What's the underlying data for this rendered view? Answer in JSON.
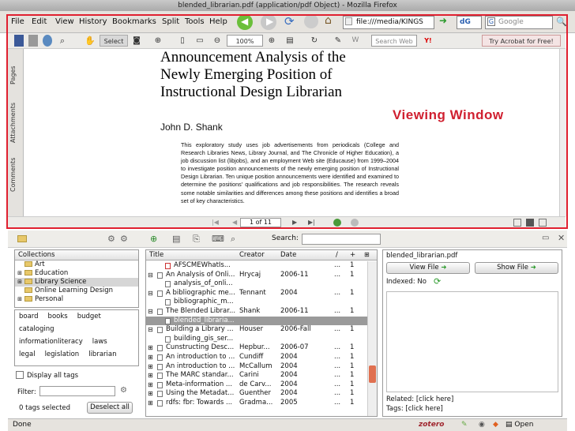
{
  "window": {
    "title": "blended_librarian.pdf (application/pdf Object) - Mozilla Firefox"
  },
  "menu": [
    "File",
    "Edit",
    "View",
    "History",
    "Bookmarks",
    "Split",
    "Tools",
    "Help"
  ],
  "nav": {
    "url": "file:///media/KINGS",
    "search_engine_label": "dG",
    "search_placeholder": "Google"
  },
  "pdf_toolbar": {
    "select_label": "Select",
    "zoom": "100%",
    "search_placeholder": "Search Web",
    "acrobat_label": "Try Acrobat for Free!"
  },
  "side_tabs": [
    "Pages",
    "Attachments",
    "Comments"
  ],
  "document": {
    "title_lines": [
      "Announcement Analysis of the",
      "Newly Emerging Position of",
      "Instructional Design Librarian"
    ],
    "author": "John D. Shank",
    "abstract": "This exploratory study uses job advertisements from periodicals (College and Research Libraries News, Library Journal, and The Chronicle of Higher Education), a job discussion list (libjobs), and an employment Web site (Educause) from 1999–2004 to investigate position announcements of the newly emerging position of Instructional Design Librarian. Ten unique position announcements were identified and examined to determine the positions' qualifications and job responsibilities. The research reveals some notable similarities and differences among these positions and identifies a broad set of key characteristics."
  },
  "annotation": {
    "viewing_window": "Viewing Window",
    "color": "#d02030"
  },
  "pdf_bottom": {
    "page": "1 of 11"
  },
  "zotero": {
    "search_label": "Search:",
    "collections_header": "Collections",
    "collections": [
      {
        "label": "Art",
        "expand": ""
      },
      {
        "label": "Education",
        "expand": "+"
      },
      {
        "label": "Library Science",
        "expand": "+"
      },
      {
        "label": "Online Learning Design",
        "expand": ""
      },
      {
        "label": "Personal",
        "expand": "+"
      }
    ],
    "tags": [
      [
        "board",
        "books",
        "budget"
      ],
      [
        "cataloging"
      ],
      [
        "informationliteracy",
        "laws"
      ],
      [
        "legal",
        "legislation",
        "librarian"
      ]
    ],
    "display_all_tags": "Display all tags",
    "filter_label": "Filter:",
    "tags_selected": "0 tags selected",
    "deselect_all": "Deselect all",
    "columns": {
      "title": "Title",
      "creator": "Creator",
      "date": "Date"
    },
    "items": [
      {
        "title": "AFSCMEWhatIs...",
        "creator": "",
        "date": "",
        "a": "...",
        "b": "1",
        "indent": 1,
        "expand": "",
        "pdf": true,
        "selected": false
      },
      {
        "title": "An Analysis of Onli...",
        "creator": "Hrycaj",
        "date": "2006-11",
        "a": "...",
        "b": "1",
        "indent": 0,
        "expand": "⊟",
        "pdf": false,
        "selected": false
      },
      {
        "title": "analysis_of_onli...",
        "creator": "",
        "date": "",
        "a": "",
        "b": "",
        "indent": 1,
        "expand": "",
        "pdf": false,
        "selected": false
      },
      {
        "title": "A bibliographic me...",
        "creator": "Tennant",
        "date": "2004",
        "a": "...",
        "b": "1",
        "indent": 0,
        "expand": "⊟",
        "pdf": false,
        "selected": false
      },
      {
        "title": "bibliographic_m...",
        "creator": "",
        "date": "",
        "a": "",
        "b": "",
        "indent": 1,
        "expand": "",
        "pdf": false,
        "selected": false
      },
      {
        "title": "The Blended Librar...",
        "creator": "Shank",
        "date": "2006-11",
        "a": "...",
        "b": "1",
        "indent": 0,
        "expand": "⊟",
        "pdf": false,
        "selected": false
      },
      {
        "title": "blended_libraria...",
        "creator": "",
        "date": "",
        "a": "",
        "b": "",
        "indent": 1,
        "expand": "",
        "pdf": false,
        "selected": true
      },
      {
        "title": "Building a Library ...",
        "creator": "Houser",
        "date": "2006-Fall",
        "a": "...",
        "b": "1",
        "indent": 0,
        "expand": "⊟",
        "pdf": false,
        "selected": false
      },
      {
        "title": "building_gis_ser...",
        "creator": "",
        "date": "",
        "a": "",
        "b": "",
        "indent": 1,
        "expand": "",
        "pdf": false,
        "selected": false
      },
      {
        "title": "Cunstructing Desc...",
        "creator": "Hepbur...",
        "date": "2006-07",
        "a": "...",
        "b": "1",
        "indent": 0,
        "expand": "⊞",
        "pdf": false,
        "selected": false
      },
      {
        "title": "An introduction to ...",
        "creator": "Cundiff",
        "date": "2004",
        "a": "...",
        "b": "1",
        "indent": 0,
        "expand": "⊞",
        "pdf": false,
        "selected": false
      },
      {
        "title": "An introduction to ...",
        "creator": "McCallum",
        "date": "2004",
        "a": "...",
        "b": "1",
        "indent": 0,
        "expand": "⊞",
        "pdf": false,
        "selected": false
      },
      {
        "title": "The MARC standar...",
        "creator": "Carini",
        "date": "2004",
        "a": "...",
        "b": "1",
        "indent": 0,
        "expand": "⊞",
        "pdf": false,
        "selected": false
      },
      {
        "title": "Meta-information ...",
        "creator": "de Carv...",
        "date": "2004",
        "a": "...",
        "b": "1",
        "indent": 0,
        "expand": "⊞",
        "pdf": false,
        "selected": false
      },
      {
        "title": "Using the Metadat...",
        "creator": "Guenther",
        "date": "2004",
        "a": "...",
        "b": "1",
        "indent": 0,
        "expand": "⊞",
        "pdf": false,
        "selected": false
      },
      {
        "title": "rdfs: fbr: Towards ...",
        "creator": "Gradma...",
        "date": "2005",
        "a": "...",
        "b": "1",
        "indent": 0,
        "expand": "⊞",
        "pdf": false,
        "selected": false
      }
    ],
    "detail": {
      "filename": "blended_librarian.pdf",
      "view_file": "View File",
      "show_file": "Show File",
      "indexed": "Indexed: No",
      "related": "Related: [click here]",
      "tags": "Tags: [click here]"
    }
  },
  "status": {
    "text": "Done",
    "zotero": "zotero",
    "open_notebook": "Open Notebook"
  }
}
